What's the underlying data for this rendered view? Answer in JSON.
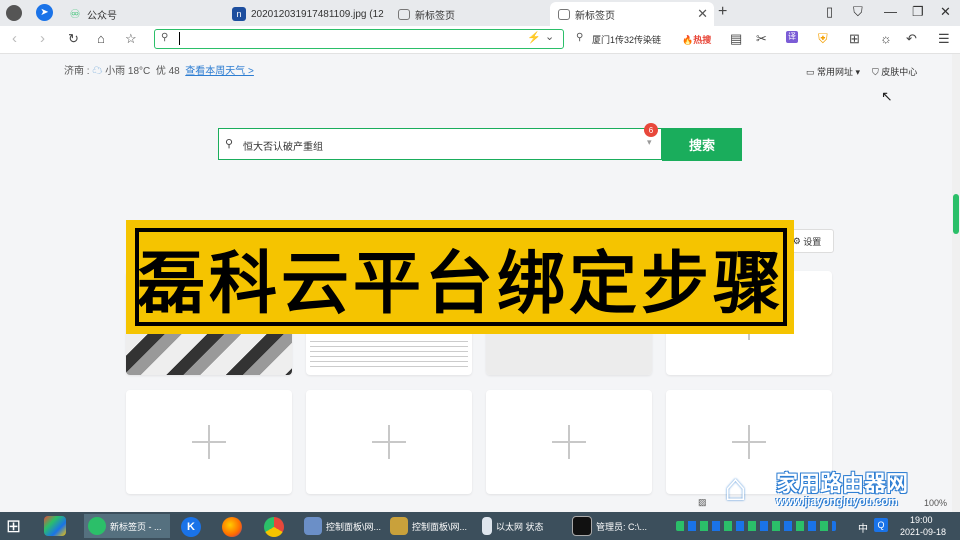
{
  "tabs": [
    {
      "label": "公众号"
    },
    {
      "label": "20201203191748110​9.jpg (12"
    },
    {
      "label": "新标签页"
    },
    {
      "label": "新标签页"
    }
  ],
  "toolbar": {
    "address_value": "",
    "search_hint": "厦门1传32传染链",
    "hot_label": "热搜"
  },
  "weather": {
    "city": "济南 :",
    "condition": "小雨 18°C",
    "aqi": "优 48",
    "link": "查看本周天气 >"
  },
  "topright": {
    "common_sites": "常用网址",
    "skin_center": "皮肤中心"
  },
  "search": {
    "value": "恒大否认破产重组",
    "badge": "6",
    "button": "搜索"
  },
  "settings_label": "设置",
  "banner": {
    "text": "磊科云平台绑定步骤"
  },
  "watermark": {
    "cn": "家用路由器网",
    "url": "www.jiayongluyou.com"
  },
  "taskbar": {
    "items": [
      {
        "label": "新标签页 - ..."
      },
      {
        "label": "控制面板\\网..."
      },
      {
        "label": "控制面板\\网..."
      },
      {
        "label": "以太网 状态"
      },
      {
        "label": "管理员: C:\\..."
      }
    ],
    "time": "19:00",
    "date": "2021-09-18",
    "ime": "中"
  },
  "statusbar": {
    "zoom": "100%"
  }
}
